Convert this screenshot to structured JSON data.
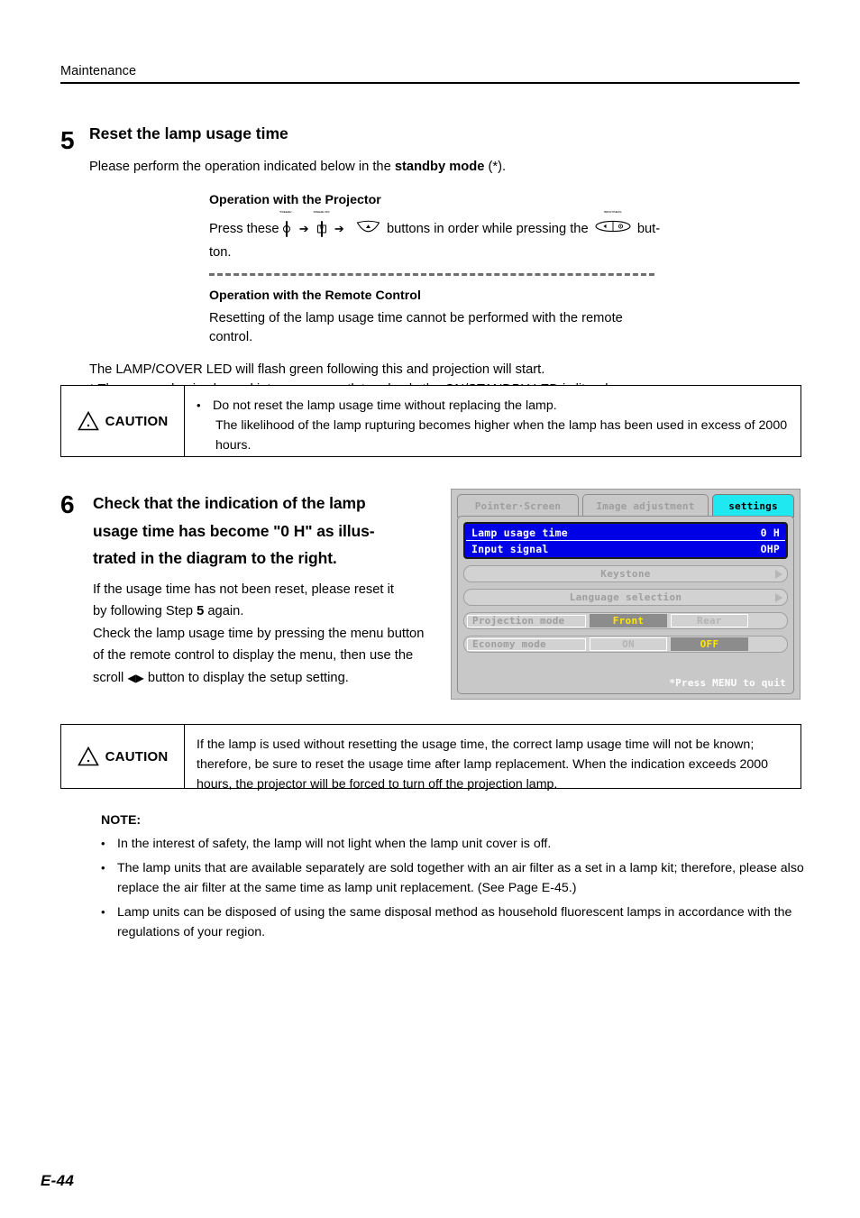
{
  "header": {
    "section_title": "Maintenance"
  },
  "step5": {
    "number": "5",
    "title": "Reset the lamp usage time",
    "lead_prefix": "Please perform the operation indicated below in the ",
    "lead_bold": "standby mode",
    "lead_suffix": " (*).",
    "projector_op_heading": "Operation with the Projector",
    "press_prefix": "Press these",
    "press_middle": "buttons in order while pressing the",
    "press_suffix": "but-",
    "press_wrap": "ton.",
    "key1_caption": "*FREEZE/...",
    "key2_caption": "FREEZE OFF",
    "key3_caption": "",
    "key4_caption": "BRIGHTNESS",
    "arrow_glyph": "➔",
    "remote_op_heading": "Operation with the Remote Control",
    "remote_op_body_line1": "Resetting of the lamp usage time cannot be performed with the remote",
    "remote_op_body_line2": "control.",
    "tail_line1": "The LAMP/COVER LED will flash green following this and projection will start.",
    "tail_line2": "* The power plug is plugged into a power outlet and only the ON/STANDBY LED is lit red."
  },
  "caution1": {
    "label": "CAUTION",
    "warning_icon": "warning-triangle",
    "bullet": "•",
    "line1": "Do not reset the lamp usage time without replacing the lamp.",
    "line2": "The likelihood of the lamp rupturing becomes higher when the lamp has been used in excess of 2000",
    "line3": "hours."
  },
  "step6": {
    "number": "6",
    "title_line1": "Check that the indication of the lamp",
    "title_line2": "usage time has become \"0 H\" as illus-",
    "title_line3": "trated in the diagram to the right.",
    "body_line1": "If the usage time has not been reset, please reset it",
    "body_line2_prefix": "by following Step ",
    "body_line2_bold": "5",
    "body_line2_suffix": " again.",
    "body_line3": "Check the lamp usage time by pressing the menu button",
    "body_line4": "of the remote control to display the menu, then use the",
    "body_line5_prefix": "scroll ",
    "body_line5_glyph": "◀▶",
    "body_line5_suffix": " button to display the setup setting."
  },
  "osd": {
    "tabs": [
      {
        "label": "Pointer·Screen",
        "active": false
      },
      {
        "label": "Image adjustment",
        "active": false
      },
      {
        "label": "settings",
        "active": true
      }
    ],
    "active_tab_color": "#20e8f0",
    "highlight_color": "#0000e6",
    "selected_text_color": "#ffe800",
    "highlighted_rows": [
      {
        "label": "Lamp usage time",
        "value": "0 H"
      },
      {
        "label": "Input signal",
        "value": "OHP"
      }
    ],
    "submenu_rows": [
      {
        "label": "Keystone",
        "arrow": "▶"
      },
      {
        "label": "Language selection",
        "arrow": "▶"
      }
    ],
    "option_rows": [
      {
        "label": "Projection mode",
        "options": [
          {
            "text": "Front",
            "selected": true
          },
          {
            "text": "Rear",
            "selected": false
          }
        ]
      },
      {
        "label": "Economy mode",
        "options": [
          {
            "text": "ON",
            "selected": false
          },
          {
            "text": "OFF",
            "selected": true
          }
        ]
      }
    ],
    "footer_hint": "*Press MENU to quit"
  },
  "caution2": {
    "label": "CAUTION",
    "warning_icon": "warning-triangle",
    "line1": "If the lamp is used without resetting the usage time, the correct lamp usage time will not be known;",
    "line2": "therefore, be sure to reset the usage time after lamp replacement. When the indication exceeds 2000",
    "line3": "hours, the projector will be forced to turn off the projection lamp."
  },
  "notes": {
    "heading": "NOTE:",
    "bullet": "•",
    "items": [
      "In the interest of safety, the lamp will not light when the lamp unit cover is off.",
      "The lamp units that are available separately are sold together with an air filter as a set in a lamp kit; therefore, please also replace the air filter at the same time as lamp unit replacement. (See Page E-45.)",
      "Lamp units can be disposed of using the same disposal method as household fluorescent lamps in accordance with the regulations of your region."
    ]
  },
  "footer": {
    "page_number": "E-44"
  }
}
